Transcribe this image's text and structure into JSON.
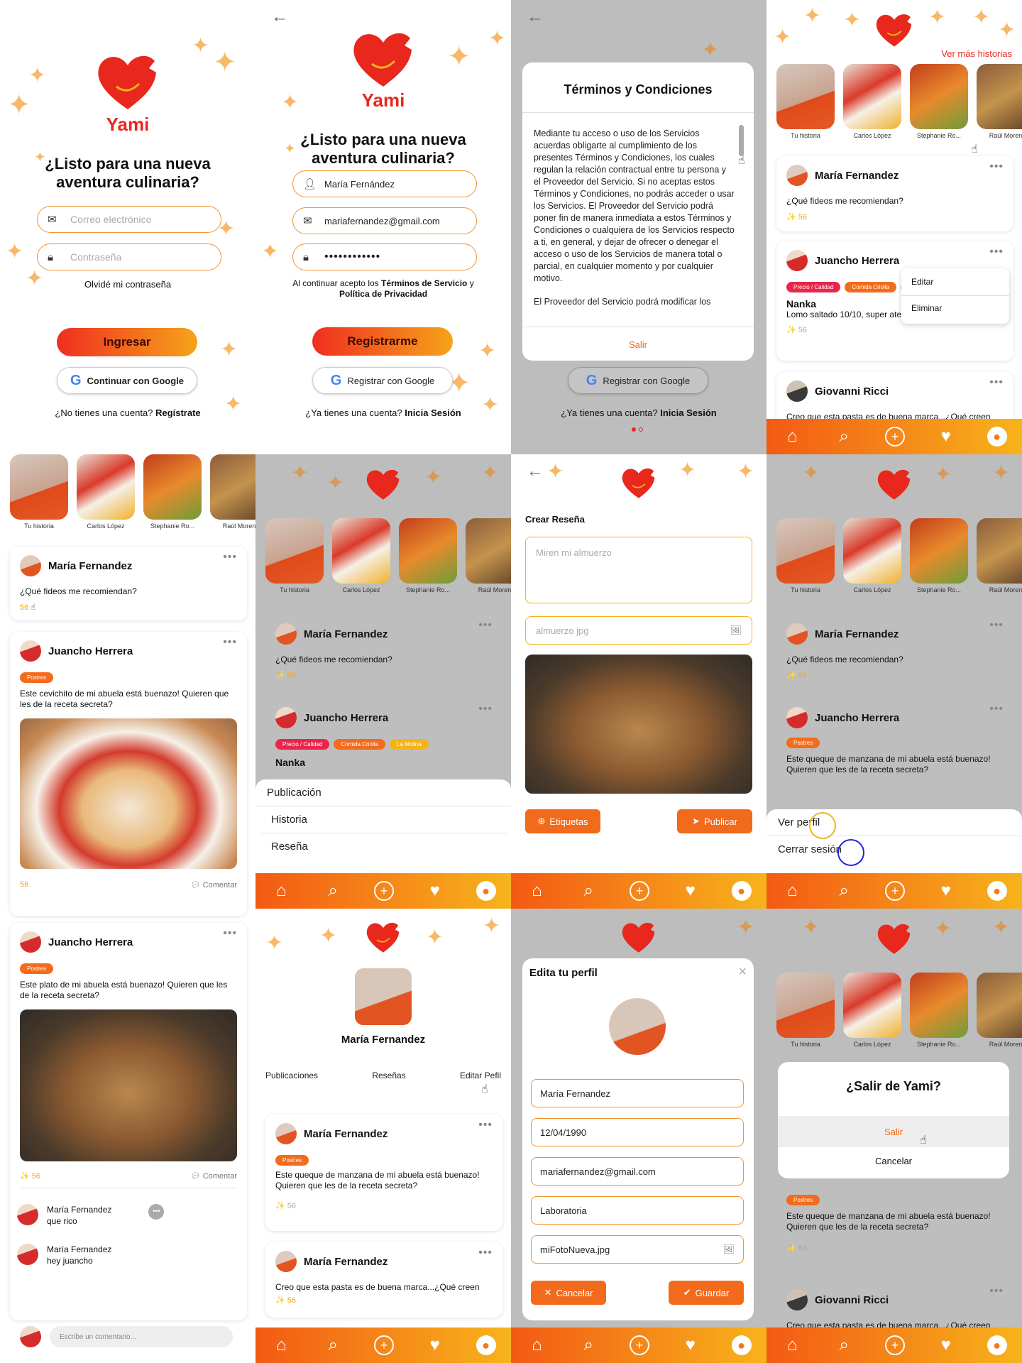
{
  "brand": {
    "name": "Yami",
    "accent": "#e8271d",
    "gradient_start": "#f35a14",
    "gradient_end": "#f7b31b"
  },
  "login": {
    "question": "¿Listo para una nueva aventura culinaria?",
    "email_placeholder": "Correo electrónico",
    "password_placeholder": "Contraseña",
    "forgot": "Olvidé mi contraseña",
    "login_button": "Ingresar",
    "google_button": "Continuar con Google",
    "no_account": "¿No tienes una cuenta?",
    "register_link": "Regístrate"
  },
  "register": {
    "question": "¿Listo para una nueva aventura culinaria?",
    "name_value": "María Fernández",
    "email_value": "mariafernandez@gmail.com",
    "password_value": "••••••••••••",
    "terms_pre": "Al continuar acepto los",
    "terms_link": "Términos de Servicio",
    "terms_mid": "y",
    "privacy_link": "Política de Privacidad",
    "register_button": "Registrarme",
    "google_button": "Registrar con Google",
    "has_account": "¿Ya tienes una cuenta?",
    "login_link": "Inicia Sesión"
  },
  "terms": {
    "title": "Términos y Condiciones",
    "body1": "Mediante tu acceso o uso de los Servicios acuerdas obligarte al cumplimiento de los presentes Términos y Condiciones, los cuales regulan la relación contractual entre tu persona y el Proveedor del Servicio. Si no aceptas estos Términos y Condiciones, no podrás acceder o usar los Servicios. El Proveedor del Servicio podrá poner fin de manera inmediata a estos Términos y Condiciones o cualquiera de los Servicios respecto a ti, en general, y dejar de ofrecer o denegar el acceso o uso de los Servicios de manera total o parcial, en cualquier momento y por cualquier motivo.",
    "body2": "El Proveedor del Servicio podrá modificar los",
    "exit": "Salir"
  },
  "feed": {
    "more_stories": "Ver más historias",
    "stories": [
      "Tu historia",
      "Carlos López",
      "Stephanie Ro...",
      "Raúl Moren"
    ],
    "post1": {
      "author": "María Fernandez",
      "text": "¿Qué fideos me recomiendan?",
      "likes": "56"
    },
    "post2": {
      "author": "Juancho Herrera",
      "tags": [
        "Precio / Calidad",
        "Comida Criolla",
        "La Molina"
      ],
      "place": "Nanka",
      "text": "Lomo saltado 10/10, super atención",
      "likes": "56"
    },
    "post3": {
      "author": "Giovanni Ricci",
      "text": "Creo que esta pasta es de buena marca...¿Qué creen"
    },
    "menu": [
      "Editar",
      "Eliminar"
    ]
  },
  "detail": {
    "post_a": {
      "author": "María Fernandez",
      "text": "¿Qué fideos me recomiendan?",
      "likes": "56"
    },
    "post_b": {
      "author": "Juancho Herrera",
      "tag": "Postres",
      "text": "Este cevichito de mi abuela está buenazo! Quieren que les de la receta secreta?",
      "likes": "56",
      "comment": "Comentar"
    },
    "post_c": {
      "author": "Juancho Herrera",
      "tag": "Postres",
      "text": "Este plato de mi abuela está buenazo! Quieren que les de la receta secreta?",
      "likes": "56",
      "comment": "Comentar"
    },
    "comments": [
      {
        "author": "María Fernandez",
        "text": "que rico"
      },
      {
        "author": "María Fernandez",
        "text": "hey juancho"
      }
    ],
    "comment_placeholder": "Escribe un comentario..."
  },
  "create_sheet": {
    "items": [
      "Publicación",
      "Historia",
      "Reseña"
    ]
  },
  "review": {
    "title": "Crear Reseña",
    "text_placeholder": "Miren mi almuerzo",
    "image_placeholder": "almuerzo jpg",
    "tags_button": "Etiquetas",
    "publish_button": "Publicar"
  },
  "profile_sheet": {
    "items": [
      "Ver perfil",
      "Cerrar sesión"
    ],
    "post_text": "Este queque de manzana de mi abuela está buenazo! Quieren que les de la receta secreta?"
  },
  "profile": {
    "name": "María Fernandez",
    "tabs": [
      "Publicaciones",
      "Reseñas",
      "Editar Pefil"
    ],
    "post1": {
      "author": "María Fernandez",
      "tag": "Postres",
      "text": "Este queque de manzana de mi abuela está buenazo! Quieren que les de la receta secreta?",
      "likes": "56"
    },
    "post2": {
      "author": "María Fernandez",
      "text": "Creo que esta pasta es de buena marca...¿Qué creen",
      "likes": "56"
    }
  },
  "edit_profile": {
    "title": "Edita tu perfil",
    "fields": [
      "María Fernandez",
      "12/04/1990",
      "mariafernandez@gmail.com",
      "Laboratoria",
      "miFotoNueva.jpg"
    ],
    "cancel": "Cancelar",
    "save": "Guardar"
  },
  "logout": {
    "question": "¿Salir de Yami?",
    "confirm": "Salir",
    "cancel": "Cancelar",
    "tag": "Postres",
    "text": "Este queque de manzana de mi abuela está buenazo! Quieren que les de la receta secreta?",
    "likes": "56",
    "author": "Giovanni Ricci",
    "text2": "Creo que esta pasta es de buena marca...¿Qué creen"
  }
}
